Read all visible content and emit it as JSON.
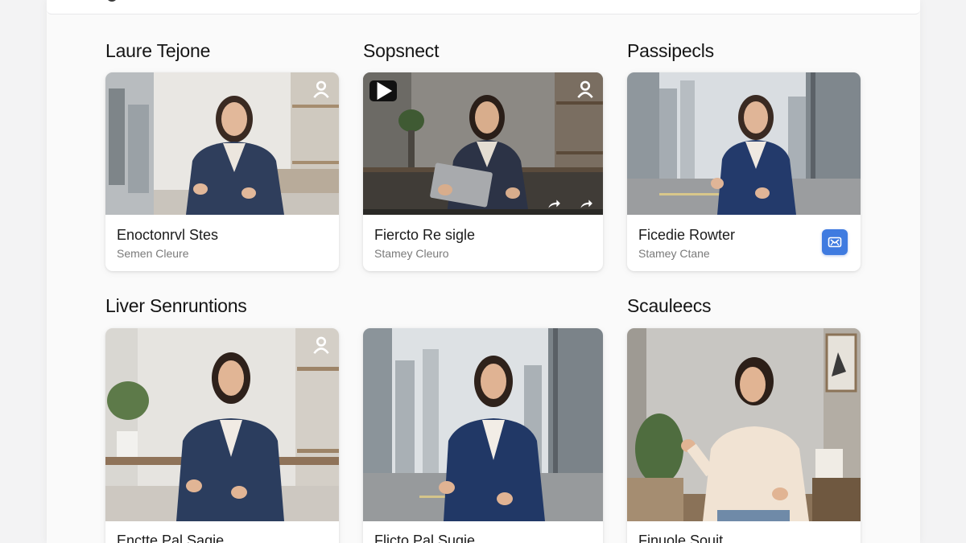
{
  "sections": [
    {
      "title": "Laure Tejone"
    },
    {
      "title": "Sopsnect"
    },
    {
      "title": "Passipecls"
    },
    {
      "title": "Liver Senruntions"
    },
    {
      "title": "Scauleecs"
    }
  ],
  "cards": [
    {
      "title": "Enoctonrvl Stes",
      "subtitle": "Semen Cleure",
      "icon": "person-icon"
    },
    {
      "title": "Fiercto Re sigle",
      "subtitle": "Stamey Cleuro",
      "icon": "person-icon",
      "badge": "play-icon",
      "controls": [
        "share-icon",
        "forward-icon"
      ]
    },
    {
      "title": "Ficedie Rowter",
      "subtitle": "Stamey Ctane",
      "action_icon": "gamepad-icon",
      "action_color": "#3f7be0"
    },
    {
      "title": "Enctte Pal Sagie",
      "icon": "person-icon"
    },
    {
      "title": "Flicto Pal Sugie"
    },
    {
      "title": "Finuole Souit"
    }
  ]
}
